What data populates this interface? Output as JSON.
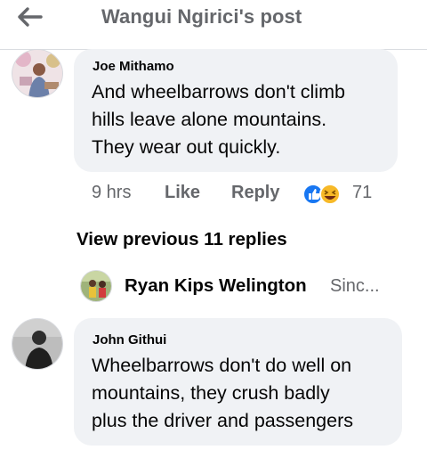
{
  "header": {
    "title": "Wangui Ngirici's post",
    "back_icon": "arrow-left-icon"
  },
  "comments": [
    {
      "author": "Joe Mithamo",
      "lines": [
        "And wheelbarrows don't climb",
        "hills leave alone mountains.",
        "They wear out quickly."
      ],
      "time": "9 hrs",
      "like_label": "Like",
      "reply_label": "Reply",
      "reactions": [
        "like-icon",
        "haha-icon"
      ],
      "reaction_count": "71"
    },
    {
      "author": "John Githui",
      "lines": [
        "Wheelbarrows don't do well on",
        "mountains, they crush badly",
        "plus the driver and passengers"
      ]
    }
  ],
  "replies": {
    "view_previous_label": "View previous 11 replies",
    "latest_author": "Ryan Kips Welington",
    "latest_snippet": "Sinc..."
  },
  "colors": {
    "bubble": "#f0f2f5",
    "secondary_text": "#65676b",
    "like_blue": "#1877f2",
    "haha_yellow": "#f7b928"
  }
}
